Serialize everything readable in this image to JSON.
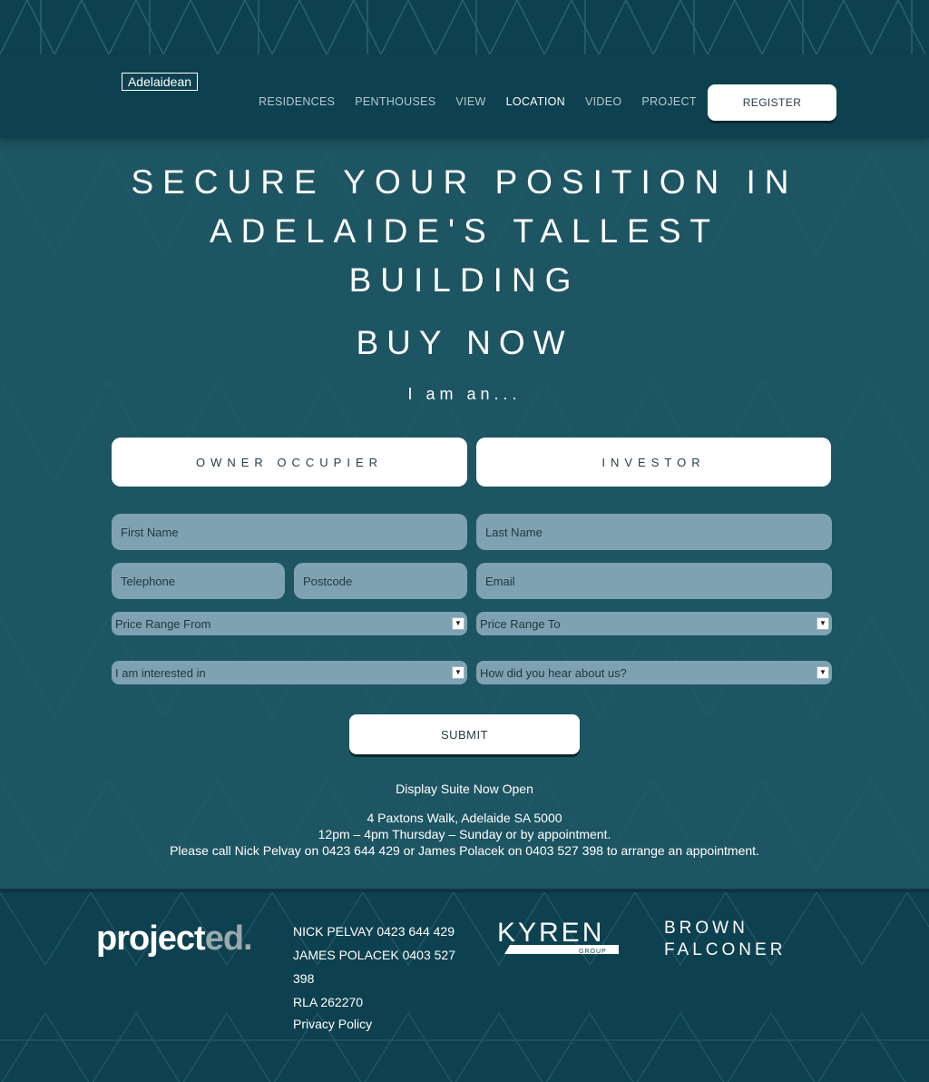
{
  "header": {
    "logo": "Adelaidean",
    "nav": [
      "RESIDENCES",
      "PENTHOUSES",
      "VIEW",
      "LOCATION",
      "VIDEO",
      "PROJECT"
    ],
    "active_nav": "LOCATION",
    "register_label": "REGISTER"
  },
  "hero": {
    "headline_line1": "SECURE YOUR POSITION IN",
    "headline_line2": "ADELAIDE'S TALLEST",
    "headline_line3": "BUILDING",
    "buy_now": "BUY NOW",
    "i_am": "I am an..."
  },
  "form": {
    "owner_occupier": "OWNER OCCUPIER",
    "investor": "INVESTOR",
    "first_name_placeholder": "First Name",
    "last_name_placeholder": "Last Name",
    "telephone_placeholder": "Telephone",
    "postcode_placeholder": "Postcode",
    "email_placeholder": "Email",
    "price_from": "Price Range From",
    "price_to": "Price Range To",
    "interested_in": "I am interested in",
    "hear_about": "How did you hear about us?",
    "submit_label": "SUBMIT"
  },
  "display_suite": {
    "title": "Display Suite Now Open",
    "address": "4 Paxtons Walk, Adelaide SA 5000",
    "hours": "12pm – 4pm Thursday – Sunday or by appointment.",
    "call": "Please call Nick Pelvay on 0423 644 429 or James Polacek on 0403 527 398 to arrange an appointment."
  },
  "footer": {
    "projected_main": "project",
    "projected_suffix": "ed.",
    "contact1": "NICK PELVAY   0423 644 429",
    "contact2": "JAMES POLACEK   0403 527 398",
    "rla": "RLA 262270",
    "privacy": "Privacy Policy",
    "kyren": "KYREN",
    "kyren_group": "GROUP",
    "brown_falconer_line1": "BROWN",
    "brown_falconer_line2": "FALCONER"
  },
  "colors": {
    "background": "#1d5563",
    "header": "#0e4150",
    "field": "#7fa2b2",
    "button": "#ffffff"
  }
}
